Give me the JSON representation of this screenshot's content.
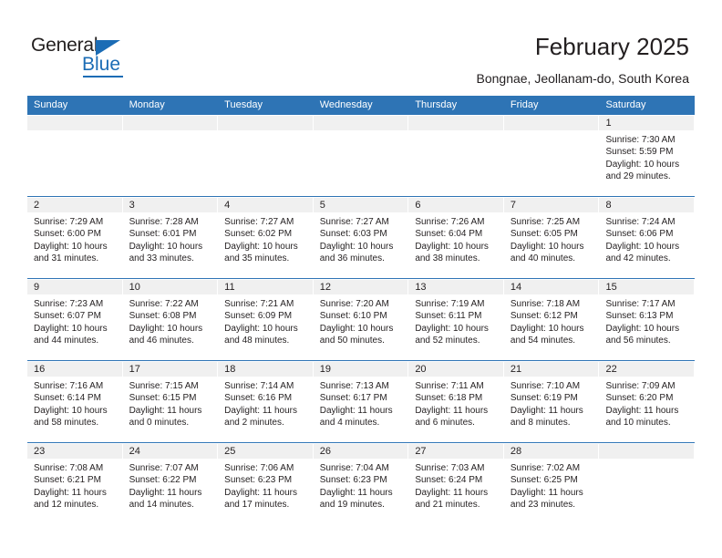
{
  "brand": {
    "name_part1": "General",
    "name_part2": "Blue",
    "accent_color": "#1b6cb5"
  },
  "header": {
    "title": "February 2025",
    "subtitle": "Bongnae, Jeollanam-do, South Korea"
  },
  "calendar": {
    "header_color": "#2e74b5",
    "weekdays": [
      "Sunday",
      "Monday",
      "Tuesday",
      "Wednesday",
      "Thursday",
      "Friday",
      "Saturday"
    ],
    "weeks": [
      [
        {
          "day": "",
          "empty": true,
          "lines": []
        },
        {
          "day": "",
          "empty": true,
          "lines": []
        },
        {
          "day": "",
          "empty": true,
          "lines": []
        },
        {
          "day": "",
          "empty": true,
          "lines": []
        },
        {
          "day": "",
          "empty": true,
          "lines": []
        },
        {
          "day": "",
          "empty": true,
          "lines": []
        },
        {
          "day": "1",
          "empty": false,
          "lines": [
            "Sunrise: 7:30 AM",
            "Sunset: 5:59 PM",
            "Daylight: 10 hours",
            "and 29 minutes."
          ]
        }
      ],
      [
        {
          "day": "2",
          "empty": false,
          "lines": [
            "Sunrise: 7:29 AM",
            "Sunset: 6:00 PM",
            "Daylight: 10 hours",
            "and 31 minutes."
          ]
        },
        {
          "day": "3",
          "empty": false,
          "lines": [
            "Sunrise: 7:28 AM",
            "Sunset: 6:01 PM",
            "Daylight: 10 hours",
            "and 33 minutes."
          ]
        },
        {
          "day": "4",
          "empty": false,
          "lines": [
            "Sunrise: 7:27 AM",
            "Sunset: 6:02 PM",
            "Daylight: 10 hours",
            "and 35 minutes."
          ]
        },
        {
          "day": "5",
          "empty": false,
          "lines": [
            "Sunrise: 7:27 AM",
            "Sunset: 6:03 PM",
            "Daylight: 10 hours",
            "and 36 minutes."
          ]
        },
        {
          "day": "6",
          "empty": false,
          "lines": [
            "Sunrise: 7:26 AM",
            "Sunset: 6:04 PM",
            "Daylight: 10 hours",
            "and 38 minutes."
          ]
        },
        {
          "day": "7",
          "empty": false,
          "lines": [
            "Sunrise: 7:25 AM",
            "Sunset: 6:05 PM",
            "Daylight: 10 hours",
            "and 40 minutes."
          ]
        },
        {
          "day": "8",
          "empty": false,
          "lines": [
            "Sunrise: 7:24 AM",
            "Sunset: 6:06 PM",
            "Daylight: 10 hours",
            "and 42 minutes."
          ]
        }
      ],
      [
        {
          "day": "9",
          "empty": false,
          "lines": [
            "Sunrise: 7:23 AM",
            "Sunset: 6:07 PM",
            "Daylight: 10 hours",
            "and 44 minutes."
          ]
        },
        {
          "day": "10",
          "empty": false,
          "lines": [
            "Sunrise: 7:22 AM",
            "Sunset: 6:08 PM",
            "Daylight: 10 hours",
            "and 46 minutes."
          ]
        },
        {
          "day": "11",
          "empty": false,
          "lines": [
            "Sunrise: 7:21 AM",
            "Sunset: 6:09 PM",
            "Daylight: 10 hours",
            "and 48 minutes."
          ]
        },
        {
          "day": "12",
          "empty": false,
          "lines": [
            "Sunrise: 7:20 AM",
            "Sunset: 6:10 PM",
            "Daylight: 10 hours",
            "and 50 minutes."
          ]
        },
        {
          "day": "13",
          "empty": false,
          "lines": [
            "Sunrise: 7:19 AM",
            "Sunset: 6:11 PM",
            "Daylight: 10 hours",
            "and 52 minutes."
          ]
        },
        {
          "day": "14",
          "empty": false,
          "lines": [
            "Sunrise: 7:18 AM",
            "Sunset: 6:12 PM",
            "Daylight: 10 hours",
            "and 54 minutes."
          ]
        },
        {
          "day": "15",
          "empty": false,
          "lines": [
            "Sunrise: 7:17 AM",
            "Sunset: 6:13 PM",
            "Daylight: 10 hours",
            "and 56 minutes."
          ]
        }
      ],
      [
        {
          "day": "16",
          "empty": false,
          "lines": [
            "Sunrise: 7:16 AM",
            "Sunset: 6:14 PM",
            "Daylight: 10 hours",
            "and 58 minutes."
          ]
        },
        {
          "day": "17",
          "empty": false,
          "lines": [
            "Sunrise: 7:15 AM",
            "Sunset: 6:15 PM",
            "Daylight: 11 hours",
            "and 0 minutes."
          ]
        },
        {
          "day": "18",
          "empty": false,
          "lines": [
            "Sunrise: 7:14 AM",
            "Sunset: 6:16 PM",
            "Daylight: 11 hours",
            "and 2 minutes."
          ]
        },
        {
          "day": "19",
          "empty": false,
          "lines": [
            "Sunrise: 7:13 AM",
            "Sunset: 6:17 PM",
            "Daylight: 11 hours",
            "and 4 minutes."
          ]
        },
        {
          "day": "20",
          "empty": false,
          "lines": [
            "Sunrise: 7:11 AM",
            "Sunset: 6:18 PM",
            "Daylight: 11 hours",
            "and 6 minutes."
          ]
        },
        {
          "day": "21",
          "empty": false,
          "lines": [
            "Sunrise: 7:10 AM",
            "Sunset: 6:19 PM",
            "Daylight: 11 hours",
            "and 8 minutes."
          ]
        },
        {
          "day": "22",
          "empty": false,
          "lines": [
            "Sunrise: 7:09 AM",
            "Sunset: 6:20 PM",
            "Daylight: 11 hours",
            "and 10 minutes."
          ]
        }
      ],
      [
        {
          "day": "23",
          "empty": false,
          "lines": [
            "Sunrise: 7:08 AM",
            "Sunset: 6:21 PM",
            "Daylight: 11 hours",
            "and 12 minutes."
          ]
        },
        {
          "day": "24",
          "empty": false,
          "lines": [
            "Sunrise: 7:07 AM",
            "Sunset: 6:22 PM",
            "Daylight: 11 hours",
            "and 14 minutes."
          ]
        },
        {
          "day": "25",
          "empty": false,
          "lines": [
            "Sunrise: 7:06 AM",
            "Sunset: 6:23 PM",
            "Daylight: 11 hours",
            "and 17 minutes."
          ]
        },
        {
          "day": "26",
          "empty": false,
          "lines": [
            "Sunrise: 7:04 AM",
            "Sunset: 6:23 PM",
            "Daylight: 11 hours",
            "and 19 minutes."
          ]
        },
        {
          "day": "27",
          "empty": false,
          "lines": [
            "Sunrise: 7:03 AM",
            "Sunset: 6:24 PM",
            "Daylight: 11 hours",
            "and 21 minutes."
          ]
        },
        {
          "day": "28",
          "empty": false,
          "lines": [
            "Sunrise: 7:02 AM",
            "Sunset: 6:25 PM",
            "Daylight: 11 hours",
            "and 23 minutes."
          ]
        },
        {
          "day": "",
          "empty": true,
          "lines": []
        }
      ]
    ]
  }
}
